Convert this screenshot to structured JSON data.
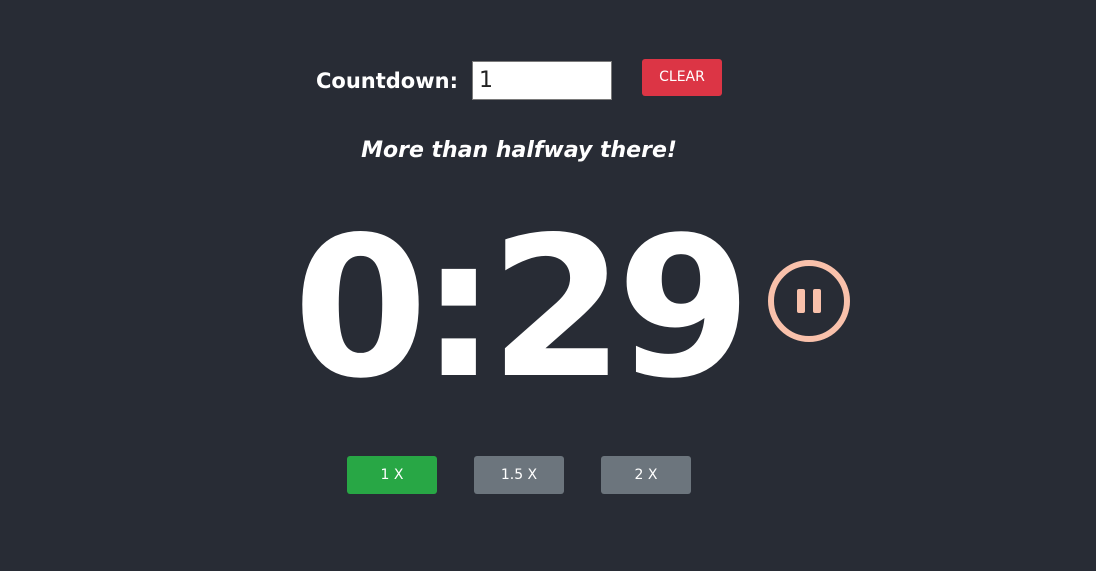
{
  "countdown": {
    "label": "Countdown:",
    "input_value": "1",
    "clear_label": "CLEAR"
  },
  "status_message": "More than halfway there!",
  "timer": {
    "display": "0:29"
  },
  "pause": {
    "icon": "pause-icon",
    "color": "#f9c1ab"
  },
  "speed": {
    "options": [
      {
        "label": "1 X",
        "active": true
      },
      {
        "label": "1.5 X",
        "active": false
      },
      {
        "label": "2 X",
        "active": false
      }
    ]
  },
  "colors": {
    "background": "#282c35",
    "clear": "#dc3545",
    "active_speed": "#28a745",
    "inactive_speed": "#6c757d"
  }
}
